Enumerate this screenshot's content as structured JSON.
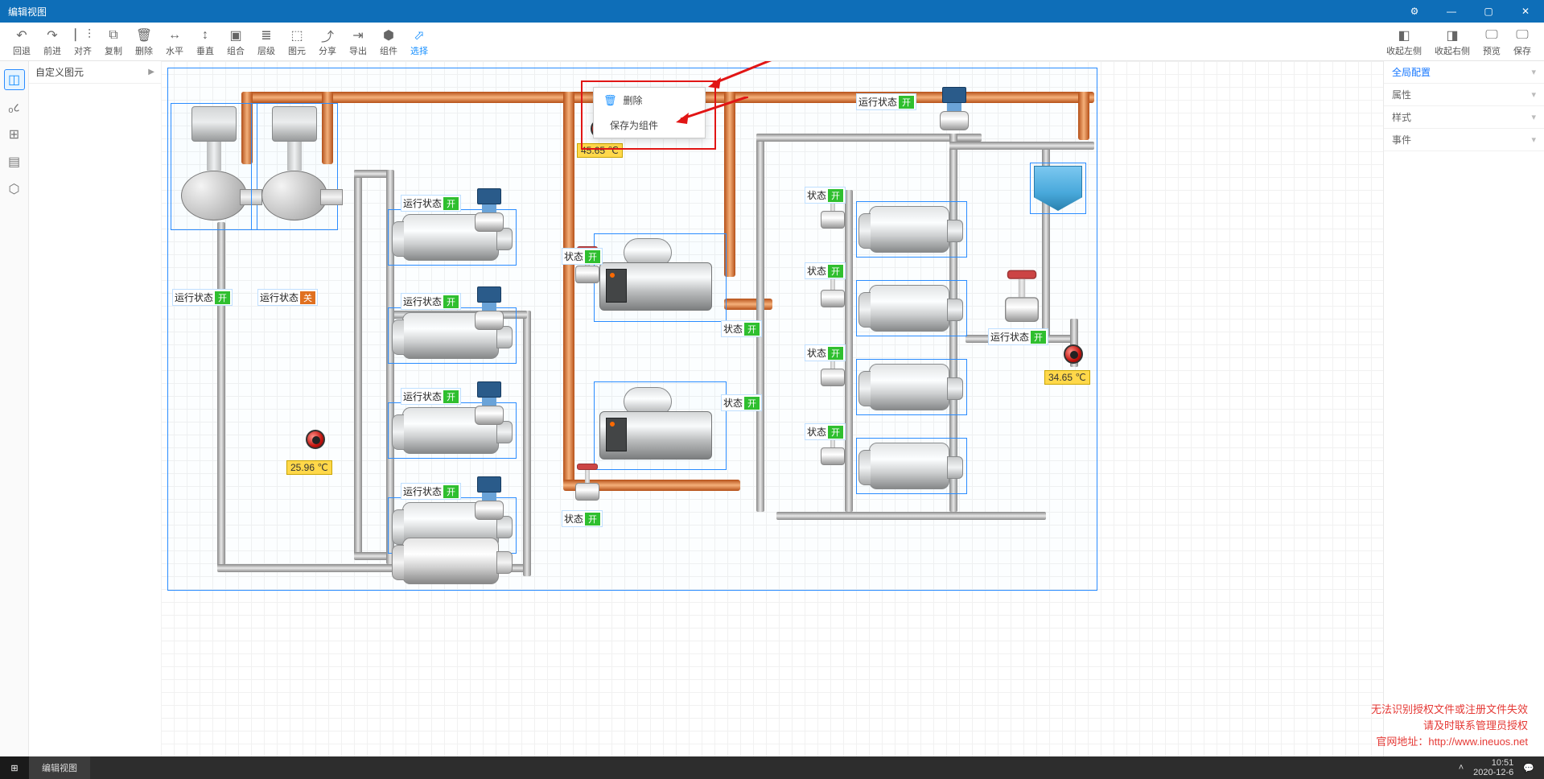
{
  "window": {
    "title": "编辑视图"
  },
  "toolbar": {
    "undo": "回退",
    "redo": "前进",
    "align": "对齐",
    "copy": "复制",
    "delete": "删除",
    "halign": "水平",
    "valign": "垂直",
    "group": "组合",
    "layer": "层级",
    "prim": "图元",
    "share": "分享",
    "export": "导出",
    "component": "组件",
    "select": "选择",
    "collapse_left": "收起左侧",
    "collapse_right": "收起右侧",
    "preview": "预览",
    "save": "保存"
  },
  "leftpanel": {
    "title": "自定义图元"
  },
  "context_menu": {
    "delete": "删除",
    "save_as_component": "保存为组件"
  },
  "rightpanel": {
    "global": "全局配置",
    "attr": "属性",
    "style": "样式",
    "event": "事件"
  },
  "status_badges": {
    "run_on": "运行状态",
    "run_off": "运行状态",
    "state": "状态",
    "on": "开",
    "off": "关"
  },
  "temps": {
    "t1": "45.65 ℃",
    "t2": "25.96 ℃",
    "t3": "34.65 ℃"
  },
  "auth_warning": {
    "line1": "无法识别授权文件或注册文件失效",
    "line2": "请及时联系管理员授权",
    "line3_pre": "官网地址：",
    "line3_url": "http://www.ineuos.net"
  },
  "taskbar": {
    "app": "编辑视图",
    "time": "10:51",
    "date": "2020-12-6"
  }
}
